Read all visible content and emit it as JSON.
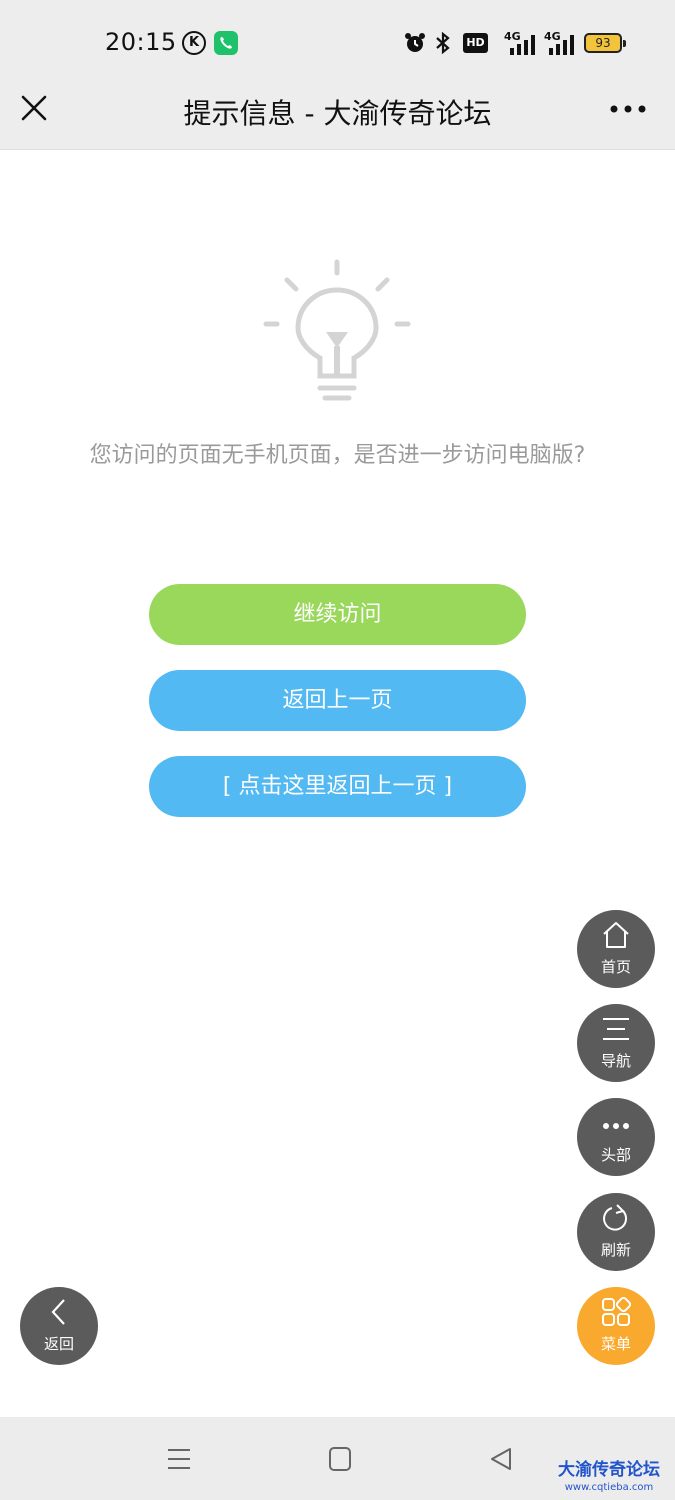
{
  "status_bar": {
    "time": "20:15",
    "k_badge": "K",
    "hd_label": "HD",
    "network_1": "4G",
    "network_2": "4G",
    "battery": "93"
  },
  "title_bar": {
    "title": "提示信息 - 大渝传奇论坛"
  },
  "content": {
    "message": "您访问的页面无手机页面，是否进一步访问电脑版?",
    "buttons": {
      "continue": "继续访问",
      "back": "返回上一页",
      "back_link": "[ 点击这里返回上一页 ]"
    }
  },
  "floating_menu": {
    "home": "首页",
    "nav": "导航",
    "head": "头部",
    "refresh": "刷新",
    "menu": "菜单",
    "return": "返回"
  },
  "watermark": {
    "name": "大渝传奇论坛",
    "url": "www.cqtieba.com"
  },
  "colors": {
    "continue_button": "#9ad85c",
    "back_button": "#52b9f3",
    "fab_dark": "#5b5b5b",
    "fab_menu": "#f8a92e"
  }
}
